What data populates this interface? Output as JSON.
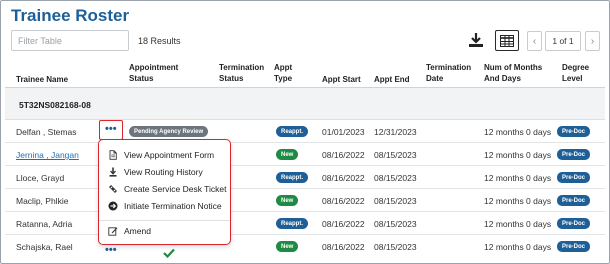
{
  "page": {
    "title": "Trainee Roster"
  },
  "toolbar": {
    "filter_placeholder": "Filter Table",
    "results": "18 Results",
    "download_icon": "download-icon",
    "grid_icon": "table-grid-icon",
    "pager": {
      "prev": "‹",
      "page_label": "1 of 1",
      "next": "›"
    }
  },
  "columns": {
    "name": "Trainee Name",
    "appt_status": [
      "Appointment",
      "Status"
    ],
    "term_status": [
      "Termination",
      "Status"
    ],
    "appt_type": [
      "Appt",
      "Type"
    ],
    "appt_start": "Appt Start",
    "appt_end": "Appt End",
    "term_date": [
      "Termination",
      "Date"
    ],
    "months_days": [
      "Num of Months",
      "And Days"
    ],
    "degree_level": [
      "Degree",
      "Level"
    ]
  },
  "group": {
    "label": "5T32NS082168-08"
  },
  "rows": [
    {
      "name": "Delfan , Stemas",
      "status": "Pending Agency Review",
      "type": "Reappt.",
      "type_color": "#1f5f97",
      "start": "01/01/2023",
      "end": "12/31/2023",
      "months": "12 months 0 days",
      "level": "Pre-Doc"
    },
    {
      "name": "Jernina , Jangan",
      "type": "New",
      "type_color": "#1e8a43",
      "start": "08/16/2022",
      "end": "08/15/2023",
      "months": "12 months 0 days",
      "level": "Pre-Doc"
    },
    {
      "name": "Lloce, Grayd",
      "type": "Reappt.",
      "type_color": "#1f5f97",
      "start": "08/16/2022",
      "end": "08/15/2023",
      "months": "12 months 0 days",
      "level": "Pre-Doc"
    },
    {
      "name": "Maclip, Phlkie",
      "type": "New",
      "type_color": "#1e8a43",
      "start": "08/16/2022",
      "end": "08/15/2023",
      "months": "12 months 0 days",
      "level": "Pre-Doc"
    },
    {
      "name": "Ratanna, Adria",
      "type": "Reappt.",
      "type_color": "#1f5f97",
      "start": "08/16/2022",
      "end": "08/15/2023",
      "months": "12 months 0 days",
      "level": "Pre-Doc"
    },
    {
      "name": "Schajska, Rael",
      "type": "New",
      "type_color": "#1e8a43",
      "start": "08/16/2022",
      "end": "08/15/2023",
      "months": "12 months 0 days",
      "level": "Pre-Doc"
    }
  ],
  "menu": {
    "items": [
      {
        "label": "View Appointment Form",
        "icon": "document-icon"
      },
      {
        "label": "View Routing History",
        "icon": "routing-history-icon"
      },
      {
        "label": "Create Service Desk Ticket",
        "icon": "ticket-icon"
      },
      {
        "label": "Initiate Termination Notice",
        "icon": "arrow-circle-icon"
      },
      {
        "label": "Amend",
        "icon": "edit-icon"
      }
    ]
  },
  "colors": {
    "title": "#1f5f97",
    "link": "#1f6fb8",
    "level_badge": "#1f5f97",
    "highlight": "#d9252b",
    "status_badge": "#6c757d",
    "check": "#1e8a43"
  }
}
